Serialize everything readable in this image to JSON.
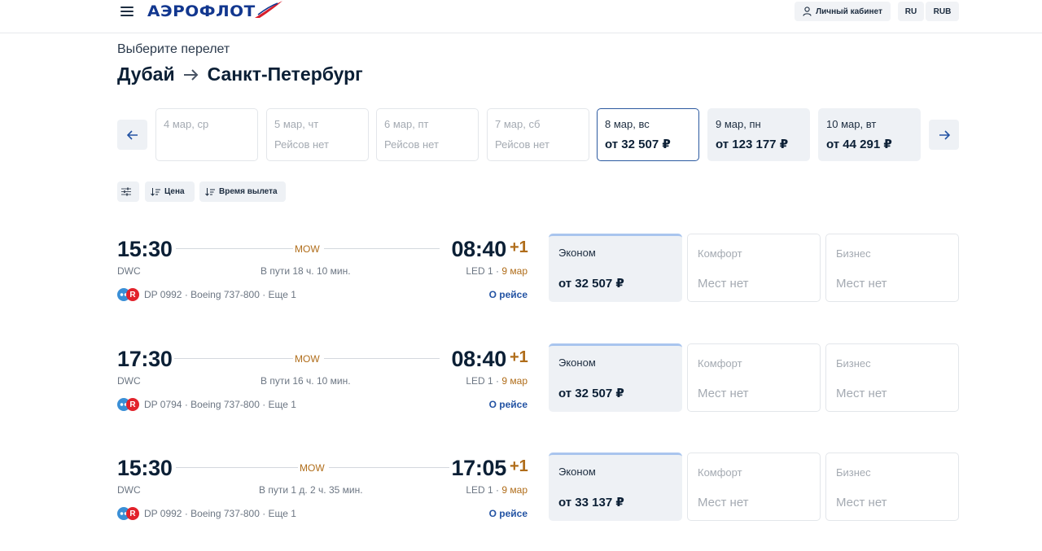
{
  "header": {
    "logo_text": "АЭРОФЛОТ",
    "cabinet_label": "Личный кабинет",
    "lang_label": "RU",
    "currency_label": "RUB"
  },
  "page": {
    "subtitle": "Выберите перелет",
    "origin": "Дубай",
    "destination": "Санкт-Петербург"
  },
  "dates": [
    {
      "date": "4 мар, ср",
      "price": "",
      "state": "empty"
    },
    {
      "date": "5 мар, чт",
      "price": "Рейсов нет",
      "state": "empty"
    },
    {
      "date": "6 мар, пт",
      "price": "Рейсов нет",
      "state": "empty"
    },
    {
      "date": "7 мар, сб",
      "price": "Рейсов нет",
      "state": "empty"
    },
    {
      "date": "8 мар, вс",
      "price": "от 32 507 ₽",
      "state": "active"
    },
    {
      "date": "9 мар, пн",
      "price": "от 123 177 ₽",
      "state": "available"
    },
    {
      "date": "10 мар, вт",
      "price": "от 44 291 ₽",
      "state": "available"
    }
  ],
  "filters": {
    "price_label": "Цена",
    "time_label": "Время вылета"
  },
  "flights": [
    {
      "dep_time": "15:30",
      "dep_code": "DWC",
      "arr_time": "08:40",
      "arr_plus": "+1",
      "arr_code": "LED 1 · ",
      "arr_date": "9 мар",
      "via": "MOW",
      "duration": "В пути 18 ч. 10 мин.",
      "airline_info": "DP 0992 · Boeing 737-800 · Еще 1",
      "about": "О рейсе",
      "fares": [
        {
          "class": "Эконом",
          "price": "от 32 507 ₽"
        },
        {
          "class": "Комфорт",
          "price": "Мест нет"
        },
        {
          "class": "Бизнес",
          "price": "Мест нет"
        }
      ]
    },
    {
      "dep_time": "17:30",
      "dep_code": "DWC",
      "arr_time": "08:40",
      "arr_plus": "+1",
      "arr_code": "LED 1 · ",
      "arr_date": "9 мар",
      "via": "MOW",
      "duration": "В пути 16 ч. 10 мин.",
      "airline_info": "DP 0794 · Boeing 737-800 · Еще 1",
      "about": "О рейсе",
      "fares": [
        {
          "class": "Эконом",
          "price": "от 32 507 ₽"
        },
        {
          "class": "Комфорт",
          "price": "Мест нет"
        },
        {
          "class": "Бизнес",
          "price": "Мест нет"
        }
      ]
    },
    {
      "dep_time": "15:30",
      "dep_code": "DWC",
      "arr_time": "17:05",
      "arr_plus": "+1",
      "arr_code": "LED 1 · ",
      "arr_date": "9 мар",
      "via": "MOW",
      "duration": "В пути 1 д. 2 ч. 35 мин.",
      "airline_info": "DP 0992 · Boeing 737-800 · Еще 1",
      "about": "О рейсе",
      "fares": [
        {
          "class": "Эконом",
          "price": "от 33 137 ₽"
        },
        {
          "class": "Комфорт",
          "price": "Мест нет"
        },
        {
          "class": "Бизнес",
          "price": "Мест нет"
        }
      ]
    }
  ],
  "colors": {
    "brand": "#12378f",
    "accent": "#2353a3",
    "next_day": "#b06d1a",
    "economy_bg": "#eef1f5"
  }
}
